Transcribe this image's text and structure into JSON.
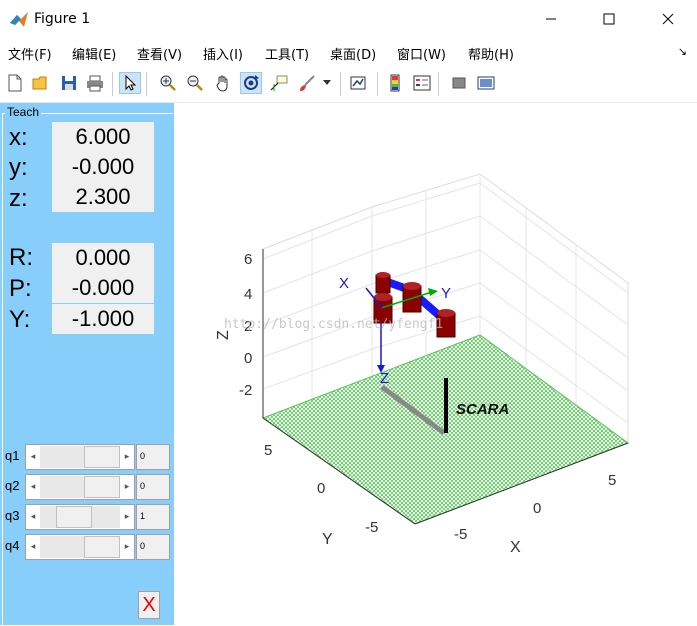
{
  "window": {
    "title": "Figure 1",
    "minimize": "—",
    "maximize": "☐",
    "close": "✕"
  },
  "menu": [
    "文件(F)",
    "编辑(E)",
    "查看(V)",
    "插入(I)",
    "工具(T)",
    "桌面(D)",
    "窗口(W)",
    "帮助(H)"
  ],
  "menu_arrow": "↘",
  "toolbar": [
    "new-file-icon",
    "open-folder-icon",
    "save-icon",
    "print-icon",
    "pointer-icon",
    "zoom-in-icon",
    "zoom-out-icon",
    "pan-hand-icon",
    "rotate-3d-icon",
    "data-cursor-icon",
    "brush-icon",
    "brush-dropdown-icon",
    "link-plot-icon",
    "colorbar-icon",
    "legend-icon",
    "hide-plot-tools-icon",
    "show-plot-tools-icon"
  ],
  "teach": {
    "title": "Teach",
    "labels": [
      "x:",
      "y:",
      "z:",
      "R:",
      "P:",
      "Y:"
    ],
    "values": [
      "6.000",
      "-0.000",
      "2.300",
      "0.000",
      "-0.000",
      "-1.000"
    ],
    "joints": [
      {
        "label": "q1",
        "value": "0",
        "position": 0.5
      },
      {
        "label": "q2",
        "value": "0",
        "position": 0.5
      },
      {
        "label": "q3",
        "value": "1",
        "position": 0.25
      },
      {
        "label": "q4",
        "value": "0",
        "position": 0.5
      }
    ],
    "close_label": "X"
  },
  "plot": {
    "z_ticks": [
      "6",
      "4",
      "2",
      "0",
      "-2"
    ],
    "y_ticks": [
      "5",
      "0",
      "-5"
    ],
    "x_ticks": [
      "5",
      "0",
      "-5"
    ],
    "z_label": "Z",
    "y_label": "Y",
    "x_label": "X",
    "robot_name": "SCARA",
    "frame_labels": [
      "X",
      "Y",
      "Z"
    ],
    "watermark": "http://blog.csdn.net/yfengf1",
    "floor_color": "#5ec45e",
    "link_color": "#1a1aff",
    "joint_color": "#8b0000"
  }
}
